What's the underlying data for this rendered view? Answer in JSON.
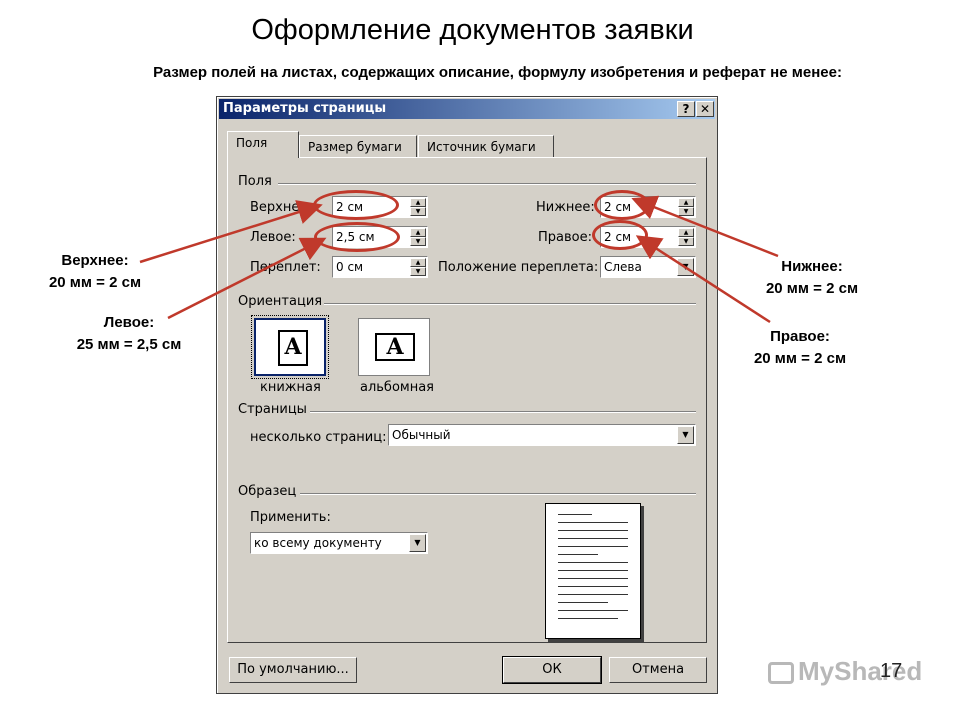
{
  "slide": {
    "title": "Оформление документов заявки",
    "subtitle": "Размер полей на листах, содержащих описание, формулу изобретения и реферат не менее:",
    "number": "17",
    "watermark": "MyShared"
  },
  "callouts": {
    "top": {
      "label": "Верхнее:",
      "value": "20 мм = 2 см"
    },
    "left": {
      "label": "Левое:",
      "value": "25 мм = 2,5 см"
    },
    "bottom": {
      "label": "Нижнее:",
      "value": "20 мм = 2 см"
    },
    "right": {
      "label": "Правое:",
      "value": "20 мм = 2 см"
    }
  },
  "dialog": {
    "title": "Параметры страницы",
    "help_btn": "?",
    "close_btn": "✕",
    "tabs": [
      "Поля",
      "Размер бумаги",
      "Источник бумаги"
    ],
    "fields_group": "Поля",
    "top_label": "Верхнее:",
    "top_value": "2 см",
    "left_label": "Левое:",
    "left_value": "2,5 см",
    "gutter_label": "Переплет:",
    "gutter_value": "0 см",
    "bottom_label": "Нижнее:",
    "bottom_value": "2 см",
    "right_label": "Правое:",
    "right_value": "2 см",
    "gutter_pos_label": "Положение переплета:",
    "gutter_pos_value": "Слева",
    "orientation_group": "Ориентация",
    "portrait": "книжная",
    "landscape": "альбомная",
    "orient_glyph": "A",
    "pages_group": "Страницы",
    "multiple_pages_label": "несколько страниц:",
    "multiple_pages_value": "Обычный",
    "sample_group": "Образец",
    "apply_label": "Применить:",
    "apply_value": "ко всему документу",
    "default_btn": "По умолчанию...",
    "ok_btn": "ОК",
    "cancel_btn": "Отмена"
  },
  "colors": {
    "highlight": "#c0392b",
    "titlebar": "#0a246a",
    "dialog_bg": "#d4d0c8"
  }
}
